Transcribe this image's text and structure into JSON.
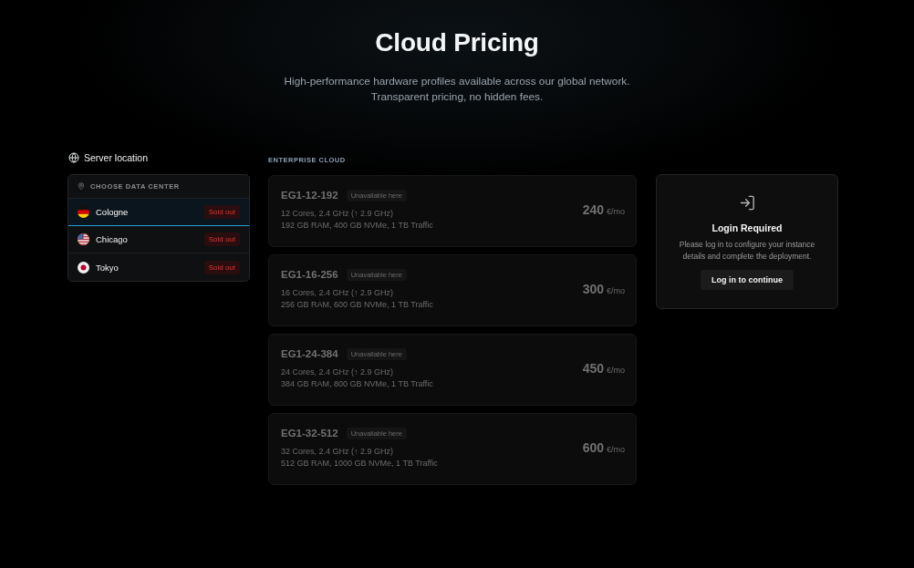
{
  "header": {
    "title": "Cloud Pricing",
    "subtitle_lines": [
      "High-performance hardware profiles available across our global network.",
      "Transparent pricing, no hidden fees."
    ]
  },
  "location_panel": {
    "heading": "Server location",
    "list_title": "CHOOSE DATA CENTER",
    "locations": [
      {
        "name": "Cologne",
        "kind": "germany",
        "badge": "Sold out",
        "selected": true
      },
      {
        "name": "Chicago",
        "kind": "usa",
        "badge": "Sold out",
        "selected": false
      },
      {
        "name": "Tokyo",
        "kind": "japan",
        "badge": "Sold out",
        "selected": false
      }
    ]
  },
  "plans_section": {
    "label": "ENTERPRISE CLOUD",
    "plans": [
      {
        "name": "EG1-12-192",
        "badge": "Unavailable here",
        "available": false,
        "specs": [
          "12 Cores, 2.4 GHz (↑ 2.9 GHz)",
          "192 GB RAM, 400 GB NVMe, 1 TB Traffic"
        ],
        "price": "240",
        "unit": "€/mo"
      },
      {
        "name": "EG1-16-256",
        "badge": "Unavailable here",
        "available": false,
        "specs": [
          "16 Cores, 2.4 GHz (↑ 2.9 GHz)",
          "256 GB RAM, 600 GB NVMe, 1 TB Traffic"
        ],
        "price": "300",
        "unit": "€/mo"
      },
      {
        "name": "EG1-24-384",
        "badge": "Unavailable here",
        "available": false,
        "specs": [
          "24 Cores, 2.4 GHz (↑ 2.9 GHz)",
          "384 GB RAM, 800 GB NVMe, 1 TB Traffic"
        ],
        "price": "450",
        "unit": "€/mo"
      },
      {
        "name": "EG1-32-512",
        "badge": "Unavailable here",
        "available": false,
        "specs": [
          "32 Cores, 2.4 GHz (↑ 2.9 GHz)",
          "512 GB RAM, 1000 GB NVMe, 1 TB Traffic"
        ],
        "price": "600",
        "unit": "€/mo"
      }
    ]
  },
  "login_card": {
    "title": "Login Required",
    "message": "Please log in to configure your instance details and complete the deployment.",
    "button": "Log in to continue"
  }
}
